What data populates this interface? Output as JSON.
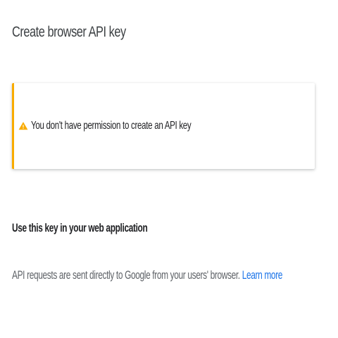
{
  "dialog": {
    "title": "Create browser API key"
  },
  "warning": {
    "icon": "warning-triangle-icon",
    "text": "You don't have permission to create an API key",
    "accent_color": "#f9ab00"
  },
  "section": {
    "heading": "Use this key in your web application",
    "description": "API requests are sent directly to Google from your users' browser.",
    "link_text": "Learn more",
    "link_color": "#1a73e8"
  }
}
